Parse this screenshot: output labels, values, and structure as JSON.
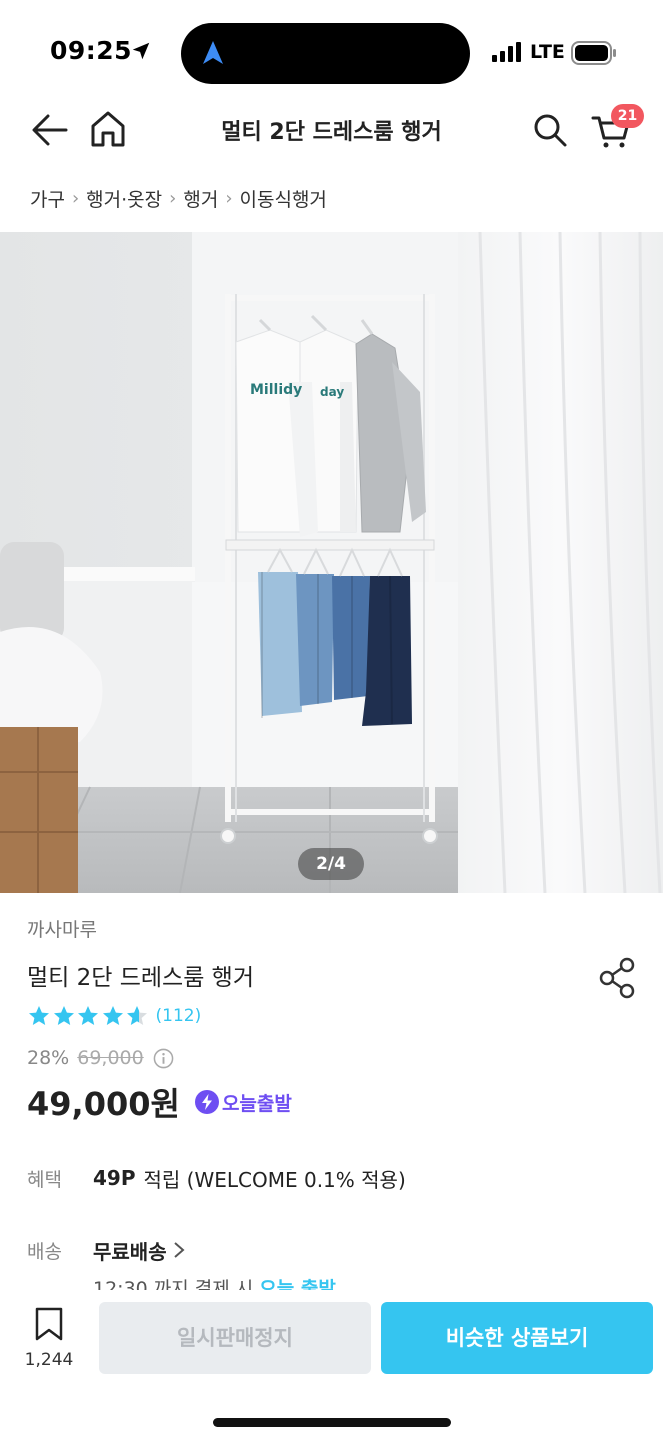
{
  "status_bar": {
    "time": "09:25",
    "network": "LTE"
  },
  "header": {
    "title": "멀티 2단 드레스룸 행거",
    "cart_count": "21"
  },
  "breadcrumb": [
    "가구",
    "행거·옷장",
    "행거",
    "이동식행거"
  ],
  "gallery": {
    "page": "2/4",
    "shirt_prints": [
      "Millidy",
      "day"
    ]
  },
  "product": {
    "brand": "까사마루",
    "name": "멀티 2단 드레스룸 행거",
    "rating": 4.5,
    "review_count": "(112)",
    "discount": "28%",
    "original_price": "69,000",
    "price": "49,000원",
    "delivery_badge": "오늘출발"
  },
  "benefit": {
    "label": "혜택",
    "points": "49P",
    "detail": "적립 (WELCOME 0.1% 적용)"
  },
  "shipping": {
    "label": "배송",
    "value": "무료배송",
    "cutoff": "12:30 까지 결제 시",
    "today": "오늘 출발"
  },
  "bottom_bar": {
    "bookmark_count": "1,244",
    "sold_out_label": "일시판매정지",
    "similar_label": "비슷한 상품보기"
  },
  "colors": {
    "accent": "#35c5f0",
    "badge": "#f2575f",
    "today_purple": "#6e4ef2",
    "star": "#35c5f0"
  },
  "icons": [
    "location-arrow-icon",
    "navigation-arrow-icon",
    "signal-icon",
    "battery-icon",
    "back-arrow-icon",
    "home-icon",
    "search-icon",
    "cart-icon",
    "share-icon",
    "star-icon",
    "info-icon",
    "lightning-icon",
    "chevron-right-icon",
    "bookmark-icon"
  ]
}
